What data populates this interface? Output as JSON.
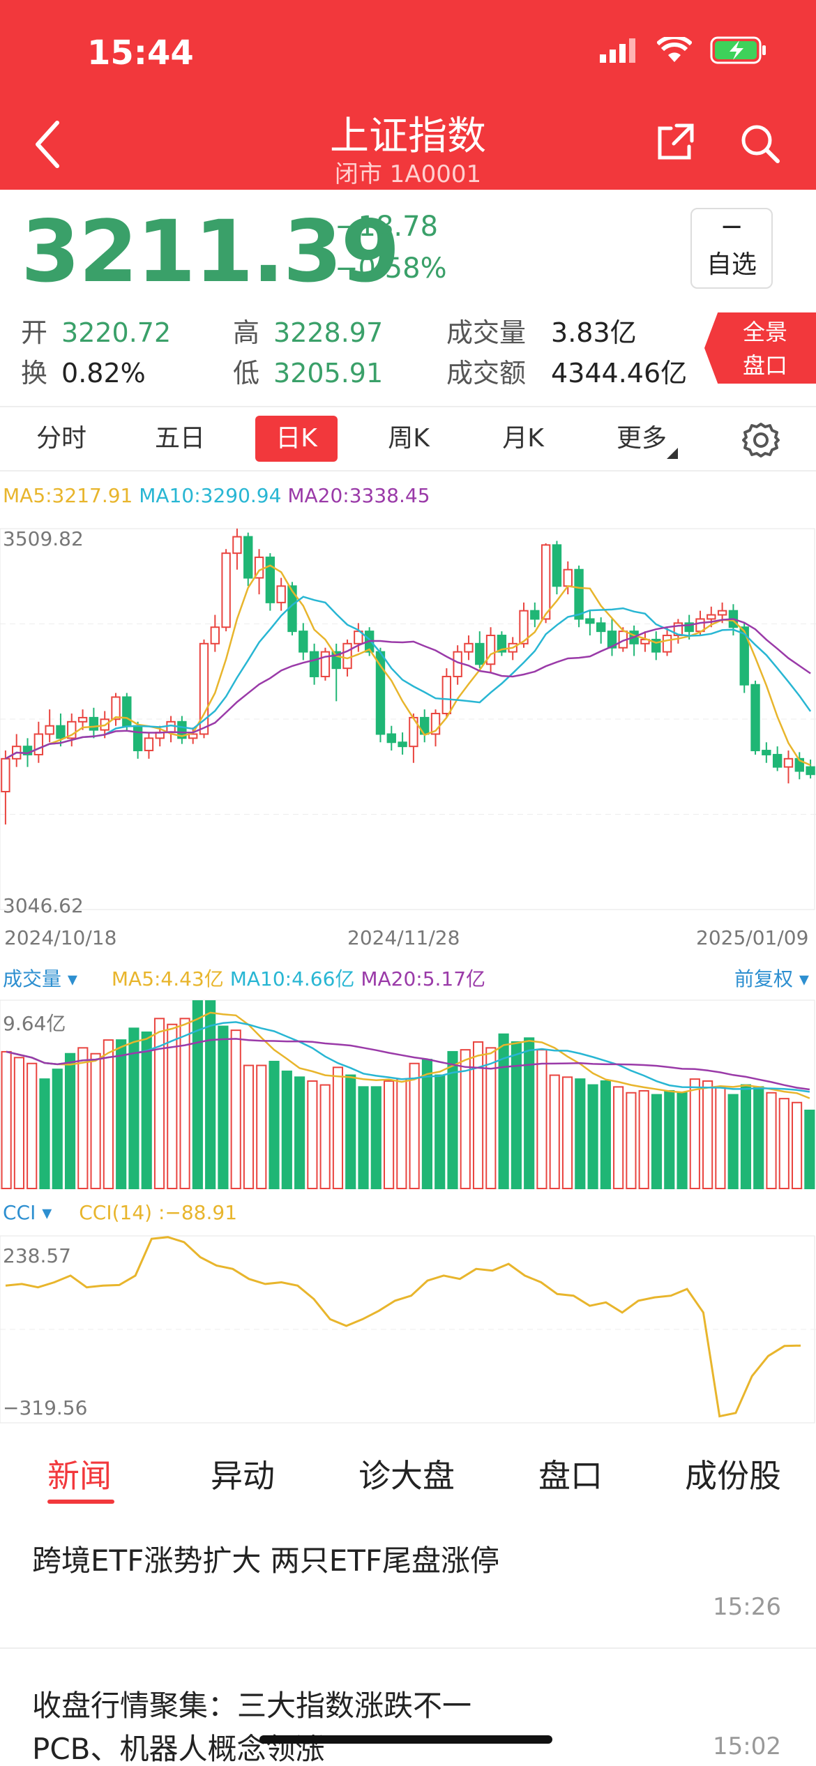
{
  "status_bar": {
    "time": "15:44"
  },
  "header": {
    "title": "上证指数",
    "subtitle": "闭市 1A0001"
  },
  "quote": {
    "price": "3211.39",
    "change": "−18.78",
    "change_pct": "−0.58%",
    "watch_dash": "−",
    "watch_label": "自选",
    "open_label": "开",
    "open": "3220.72",
    "turnover_label": "换",
    "turnover": "0.82%",
    "high_label": "高",
    "high": "3228.97",
    "low_label": "低",
    "low": "3205.91",
    "volume_label": "成交量",
    "volume": "3.83亿",
    "amount_label": "成交额",
    "amount": "4344.46亿",
    "panorama_line1": "全景",
    "panorama_line2": "盘口"
  },
  "period_tabs": [
    "分时",
    "五日",
    "日K",
    "周K",
    "月K",
    "更多"
  ],
  "active_period": "日K",
  "kline": {
    "ma5": "MA5:3217.91",
    "ma10": "MA10:3290.94",
    "ma20": "MA20:3338.45",
    "max_label": "3509.82",
    "min_label": "3046.62",
    "dates": [
      "2024/10/18",
      "2024/11/28",
      "2025/01/09"
    ]
  },
  "volume": {
    "title": "成交量 ▾",
    "ma5": "MA5:4.43亿",
    "ma10": "MA10:4.66亿",
    "ma20": "MA20:5.17亿",
    "max_label": "9.64亿",
    "adjust": "前复权 ▾"
  },
  "cci": {
    "title": "CCI ▾",
    "value": "CCI(14) :−88.91",
    "max_label": "238.57",
    "min_label": "−319.56"
  },
  "news_tabs": [
    "新闻",
    "异动",
    "诊大盘",
    "盘口",
    "成份股"
  ],
  "news": [
    {
      "title": "跨境ETF涨势扩大 两只ETF尾盘涨停",
      "time": "15:26"
    },
    {
      "title_line1": "收盘行情聚集：三大指数涨跌不一",
      "title_line2": "PCB、机器人概念领涨",
      "time": "15:02"
    }
  ],
  "colors": {
    "up": "#e9443f",
    "down": "#1fb675",
    "brand": "#f2383c",
    "ma5": "#e8b52c",
    "ma10": "#28b6d3",
    "ma20": "#9a3aa8"
  },
  "chart_data": [
    {
      "type": "candlestick",
      "title": "",
      "ylim": [
        3046.62,
        3509.82
      ],
      "x_ticks": [
        "2024/10/18",
        "2024/11/28",
        "2025/01/09"
      ],
      "candles": [
        [
          3190,
          3230,
          3150,
          3240
        ],
        [
          3230,
          3245,
          3220,
          3260
        ],
        [
          3245,
          3235,
          3220,
          3255
        ],
        [
          3235,
          3260,
          3225,
          3275
        ],
        [
          3260,
          3270,
          3250,
          3290
        ],
        [
          3270,
          3255,
          3245,
          3285
        ],
        [
          3255,
          3275,
          3245,
          3285
        ],
        [
          3275,
          3280,
          3265,
          3290
        ],
        [
          3280,
          3265,
          3255,
          3292
        ],
        [
          3265,
          3278,
          3255,
          3288
        ],
        [
          3278,
          3305,
          3270,
          3310
        ],
        [
          3305,
          3270,
          3265,
          3310
        ],
        [
          3270,
          3240,
          3230,
          3275
        ],
        [
          3240,
          3255,
          3230,
          3262
        ],
        [
          3255,
          3262,
          3245,
          3270
        ],
        [
          3262,
          3275,
          3250,
          3282
        ],
        [
          3275,
          3255,
          3248,
          3282
        ],
        [
          3255,
          3260,
          3248,
          3268
        ],
        [
          3260,
          3370,
          3255,
          3375
        ],
        [
          3370,
          3390,
          3360,
          3405
        ],
        [
          3390,
          3480,
          3385,
          3485
        ],
        [
          3480,
          3500,
          3460,
          3510
        ],
        [
          3500,
          3450,
          3440,
          3505
        ],
        [
          3450,
          3475,
          3430,
          3485
        ],
        [
          3475,
          3420,
          3410,
          3480
        ],
        [
          3420,
          3440,
          3410,
          3450
        ],
        [
          3440,
          3385,
          3380,
          3445
        ],
        [
          3385,
          3360,
          3350,
          3395
        ],
        [
          3360,
          3330,
          3320,
          3370
        ],
        [
          3330,
          3360,
          3325,
          3365
        ],
        [
          3360,
          3340,
          3300,
          3370
        ],
        [
          3340,
          3370,
          3330,
          3375
        ],
        [
          3370,
          3385,
          3360,
          3395
        ],
        [
          3385,
          3360,
          3355,
          3390
        ],
        [
          3360,
          3260,
          3250,
          3365
        ],
        [
          3260,
          3250,
          3240,
          3270
        ],
        [
          3250,
          3245,
          3235,
          3262
        ],
        [
          3245,
          3280,
          3225,
          3285
        ],
        [
          3280,
          3260,
          3250,
          3290
        ],
        [
          3260,
          3285,
          3245,
          3290
        ],
        [
          3285,
          3330,
          3280,
          3340
        ],
        [
          3330,
          3360,
          3320,
          3368
        ],
        [
          3360,
          3370,
          3350,
          3380
        ],
        [
          3370,
          3345,
          3340,
          3385
        ],
        [
          3345,
          3380,
          3335,
          3390
        ],
        [
          3380,
          3360,
          3355,
          3385
        ],
        [
          3360,
          3370,
          3350,
          3378
        ],
        [
          3370,
          3410,
          3365,
          3420
        ],
        [
          3410,
          3400,
          3390,
          3420
        ],
        [
          3400,
          3490,
          3395,
          3492
        ],
        [
          3490,
          3440,
          3430,
          3495
        ],
        [
          3440,
          3460,
          3430,
          3470
        ],
        [
          3460,
          3400,
          3390,
          3465
        ],
        [
          3400,
          3395,
          3380,
          3410
        ],
        [
          3395,
          3385,
          3370,
          3402
        ],
        [
          3385,
          3365,
          3355,
          3400
        ],
        [
          3365,
          3385,
          3360,
          3390
        ],
        [
          3385,
          3370,
          3355,
          3392
        ],
        [
          3370,
          3375,
          3360,
          3385
        ],
        [
          3375,
          3360,
          3350,
          3385
        ],
        [
          3360,
          3380,
          3355,
          3390
        ],
        [
          3380,
          3395,
          3370,
          3400
        ],
        [
          3395,
          3385,
          3375,
          3405
        ],
        [
          3385,
          3400,
          3380,
          3410
        ],
        [
          3400,
          3405,
          3390,
          3415
        ],
        [
          3405,
          3410,
          3395,
          3420
        ],
        [
          3410,
          3390,
          3380,
          3418
        ],
        [
          3390,
          3320,
          3310,
          3395
        ],
        [
          3320,
          3240,
          3235,
          3325
        ],
        [
          3240,
          3235,
          3225,
          3250
        ],
        [
          3235,
          3220,
          3215,
          3245
        ],
        [
          3220,
          3230,
          3200,
          3240
        ],
        [
          3230,
          3215,
          3205,
          3238
        ],
        [
          3220,
          3211,
          3206,
          3229
        ]
      ]
    },
    {
      "type": "bar",
      "title": "",
      "ylim": [
        0,
        9.64
      ],
      "values": [
        7.0,
        6.7,
        6.4,
        5.6,
        6.1,
        6.9,
        7.2,
        6.9,
        7.6,
        7.6,
        8.2,
        8.0,
        8.7,
        8.4,
        8.7,
        9.6,
        9.6,
        8.3,
        8.1,
        6.3,
        6.3,
        6.5,
        6.0,
        5.7,
        5.5,
        5.3,
        6.2,
        5.8,
        5.2,
        5.2,
        5.5,
        5.6,
        6.4,
        6.6,
        5.8,
        7.0,
        7.1,
        7.5,
        7.2,
        7.9,
        7.5,
        7.7,
        7.1,
        5.8,
        5.7,
        5.6,
        5.3,
        5.5,
        5.2,
        4.9,
        5.0,
        4.8,
        5.0,
        4.9,
        5.6,
        5.5,
        5.2,
        4.8,
        5.3,
        5.2,
        4.9,
        4.6,
        4.4,
        4.0
      ],
      "colors_up_down": "rgmix"
    },
    {
      "type": "line",
      "title": "",
      "ylabel": "CCI(14)",
      "ylim": [
        -319.56,
        238.57
      ],
      "values": [
        90,
        95,
        85,
        100,
        120,
        85,
        90,
        92,
        120,
        230,
        235,
        220,
        175,
        150,
        140,
        110,
        95,
        100,
        90,
        50,
        -10,
        -30,
        -10,
        15,
        45,
        60,
        105,
        120,
        110,
        140,
        135,
        155,
        120,
        100,
        65,
        60,
        30,
        40,
        10,
        45,
        55,
        60,
        80,
        10,
        -300,
        -290,
        -180,
        -120,
        -90,
        -88.91
      ]
    }
  ]
}
